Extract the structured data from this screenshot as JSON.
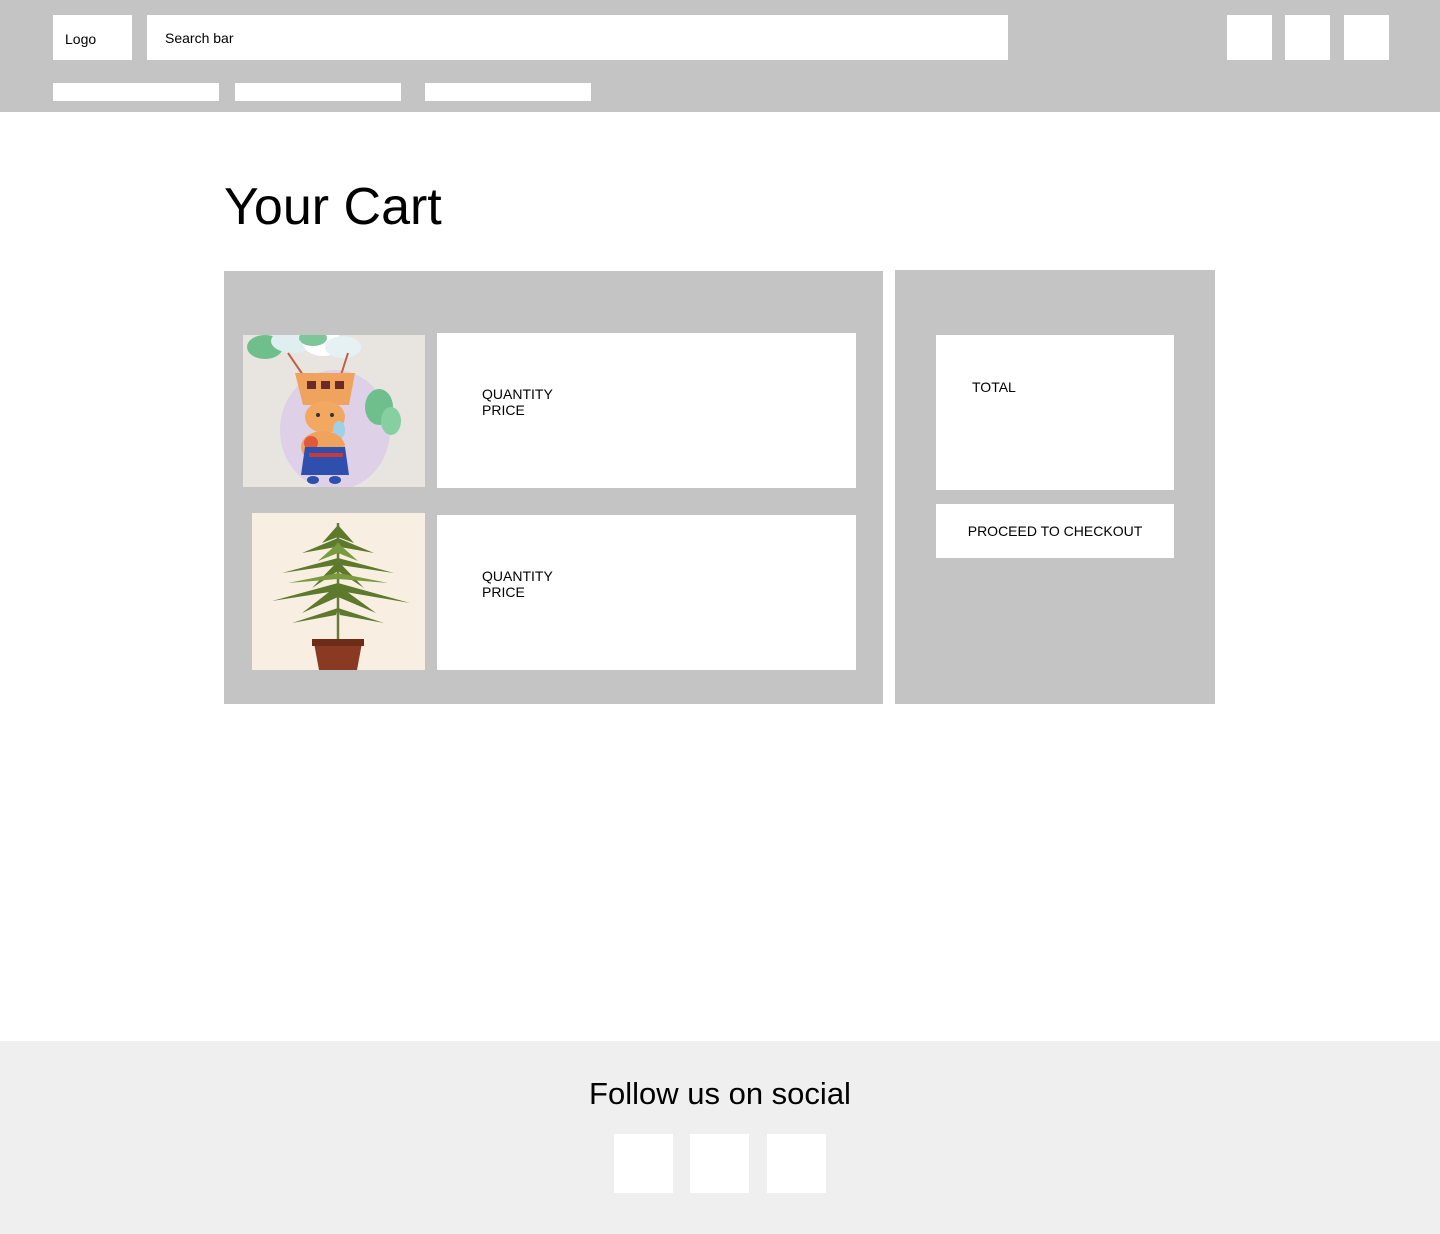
{
  "header": {
    "logo": "Logo",
    "search": {
      "placeholder": "Search bar"
    },
    "icon_buttons": [
      "header-icon-button-1",
      "header-icon-button-2",
      "header-icon-button-3"
    ],
    "nav_items": [
      "",
      "",
      ""
    ]
  },
  "main": {
    "title": "Your Cart",
    "items": [
      {
        "image": "cartoon-bear-balloon-sticker",
        "quantity_label": "QUANTITY",
        "price_label": "PRICE"
      },
      {
        "image": "potted-plant",
        "quantity_label": "QUANTITY",
        "price_label": "PRICE"
      }
    ]
  },
  "summary": {
    "total_label": "TOTAL",
    "checkout_label": "PROCEED TO CHECKOUT"
  },
  "footer": {
    "title": "Follow us on social",
    "social_icons": [
      "social-icon-1",
      "social-icon-2",
      "social-icon-3"
    ]
  },
  "colors": {
    "panel_gray": "#c4c4c4",
    "footer_gray": "#efefef",
    "card_white": "#ffffff"
  }
}
